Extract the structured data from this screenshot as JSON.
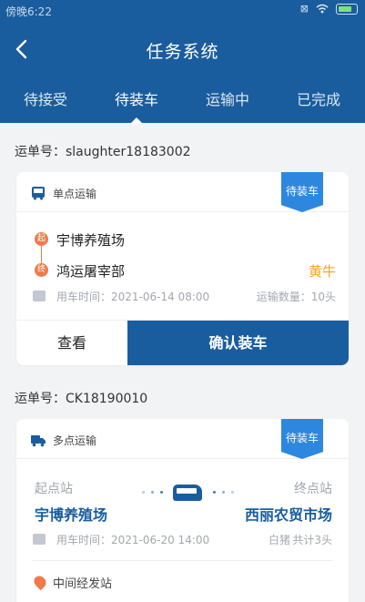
{
  "status_bar": {
    "time": "傍晚6:22",
    "icons": [
      "close-box-icon",
      "wifi-icon",
      "battery-icon"
    ]
  },
  "header": {
    "title": "任务系统",
    "back_icon": "chevron-left-icon",
    "tabs": [
      {
        "label": "待接受",
        "active": false
      },
      {
        "label": "待装车",
        "active": true
      },
      {
        "label": "运输中",
        "active": false
      },
      {
        "label": "已完成",
        "active": false
      }
    ]
  },
  "colors": {
    "primary": "#1a5d9e",
    "badge": "#2d87df",
    "accent_orange": "#f07a4a",
    "livestock_text": "#f0a22a"
  },
  "orders": [
    {
      "waybill": "运单号：slaughter18183002",
      "type_label": "单点运输",
      "type_icon": "bus-icon",
      "status_badge": "待装车",
      "start_marker": "起",
      "end_marker": "终",
      "from": "宇博养殖场",
      "to": "鸿运屠宰部",
      "livestock": "黄牛",
      "time": "用车时间：2021-06-14 08:00",
      "count": "运输数量：10头",
      "view_label": "查看",
      "confirm_label": "确认装车"
    },
    {
      "waybill": "运单号：CK18190010",
      "type_label": "多点运输",
      "type_icon": "truck-icon",
      "status_badge": "待装车",
      "start_station_label": "起点站",
      "end_station_label": "终点站",
      "from": "宇博养殖场",
      "to": "西丽农贸市场",
      "time": "用车时间：2021-06-20 14:00",
      "livestock": "白猪",
      "count": "共计3头",
      "midway_label": "中间经发站"
    }
  ]
}
